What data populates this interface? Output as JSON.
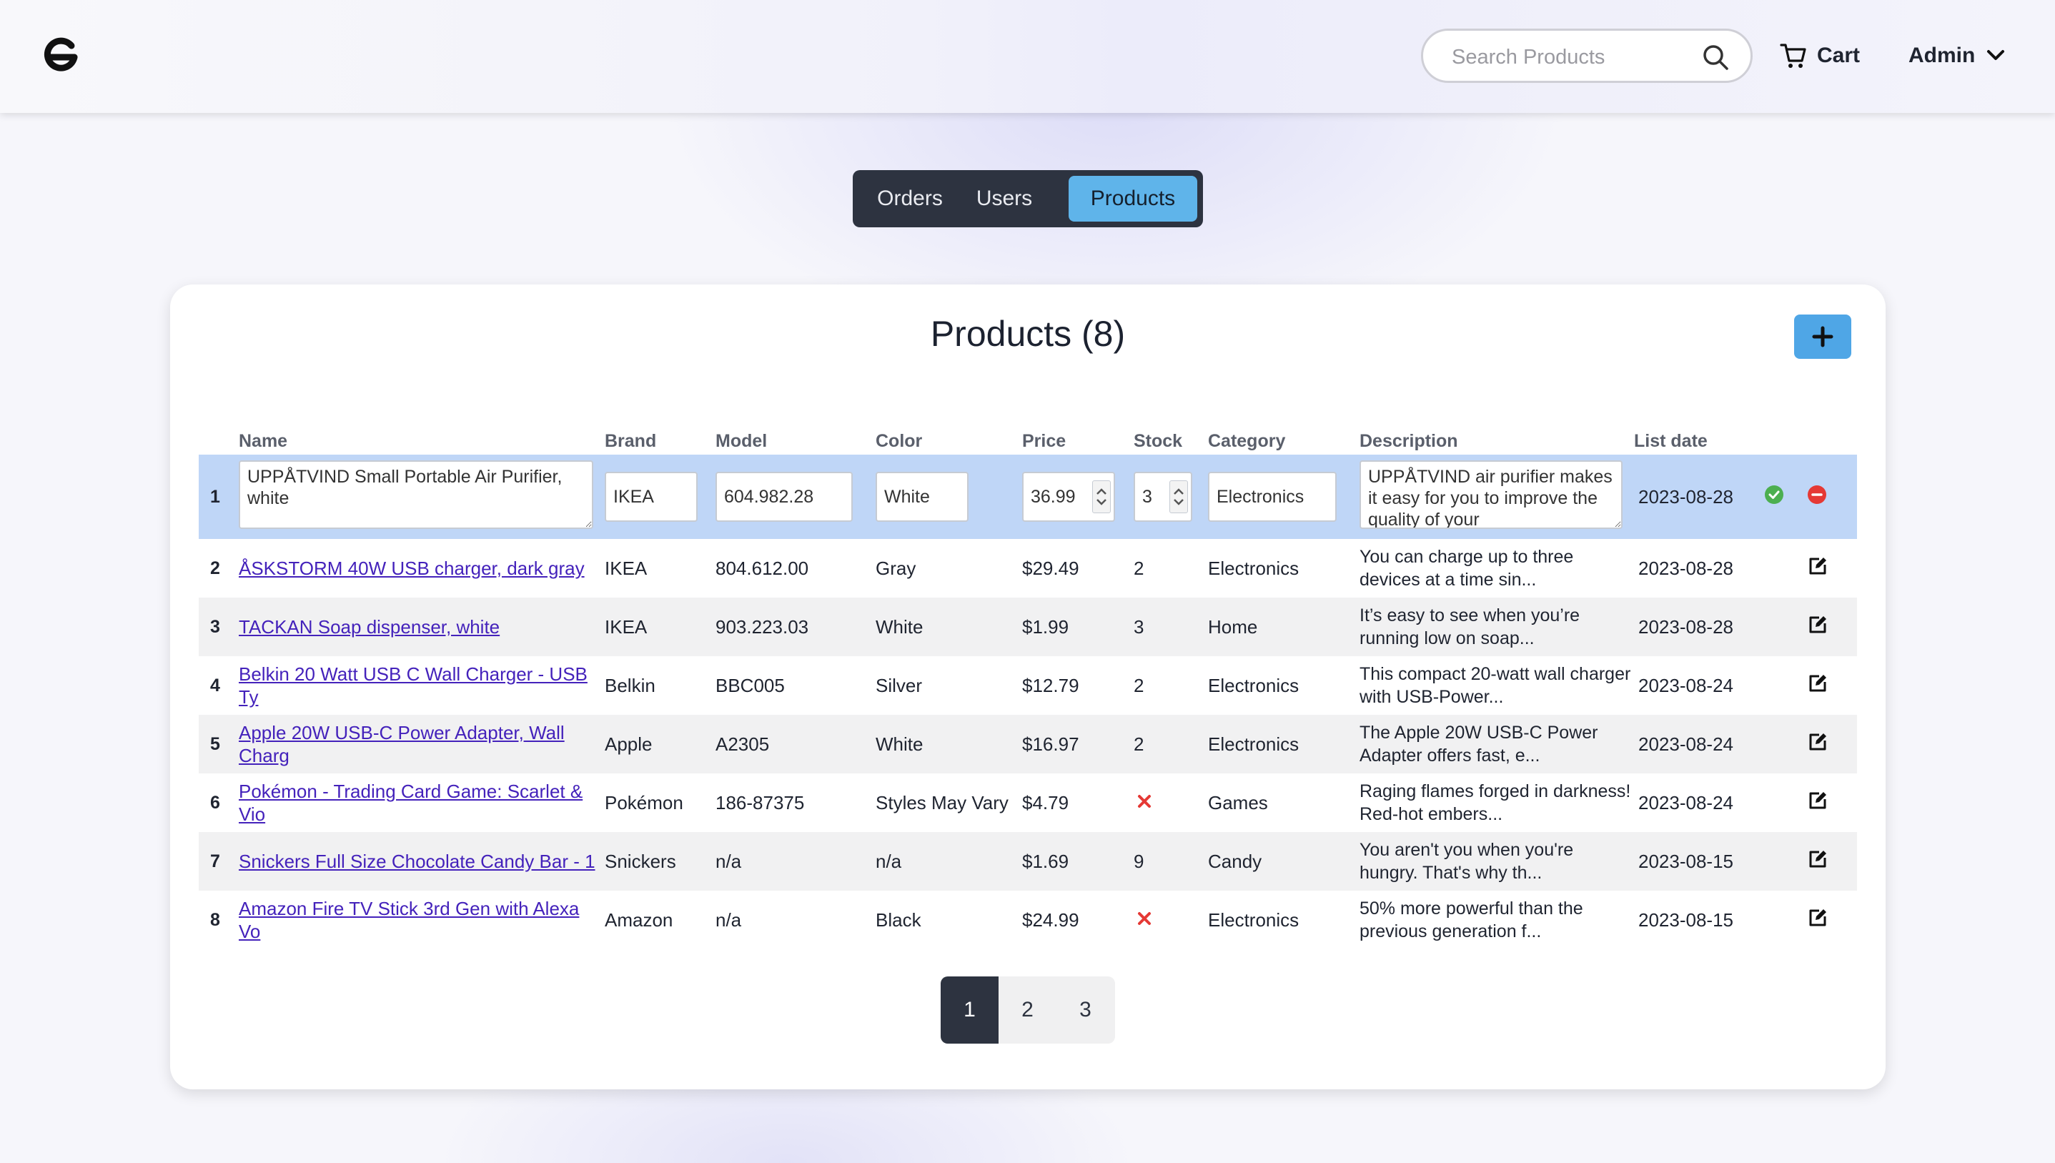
{
  "header": {
    "logo": "e-logo",
    "search": {
      "placeholder": "Search Products",
      "value": ""
    },
    "cart_label": "Cart",
    "user_label": "Admin"
  },
  "tabs": [
    {
      "label": "Orders",
      "active": false
    },
    {
      "label": "Users",
      "active": false
    },
    {
      "label": "Products",
      "active": true
    }
  ],
  "products": {
    "title": "Products (8)",
    "columns": [
      "Name",
      "Brand",
      "Model",
      "Color",
      "Price",
      "Stock",
      "Category",
      "Description",
      "List date"
    ],
    "editing_row": {
      "index": "1",
      "name": "UPPÅTVIND Small Portable Air Purifier, white",
      "brand": "IKEA",
      "model": "604.982.28",
      "color": "White",
      "price": "36.99",
      "stock": "3",
      "category": "Electronics",
      "description": "UPPÅTVIND air purifier makes it easy for you to improve the quality of your",
      "list_date": "2023-08-28"
    },
    "rows": [
      {
        "index": "2",
        "name": "ÅSKSTORM 40W USB charger, dark gray",
        "brand": "IKEA",
        "model": "804.612.00",
        "color": "Gray",
        "price": "$29.49",
        "stock": "2",
        "category": "Electronics",
        "description": "You can charge up to three devices at a time sin...",
        "list_date": "2023-08-28"
      },
      {
        "index": "3",
        "name": "TACKAN Soap dispenser, white",
        "brand": "IKEA",
        "model": "903.223.03",
        "color": "White",
        "price": "$1.99",
        "stock": "3",
        "category": "Home",
        "description": "It’s easy to see when you’re running low on soap...",
        "list_date": "2023-08-28"
      },
      {
        "index": "4",
        "name": "Belkin 20 Watt USB C Wall Charger - USB Ty",
        "brand": "Belkin",
        "model": "BBC005",
        "color": "Silver",
        "price": "$12.79",
        "stock": "2",
        "category": "Electronics",
        "description": "This compact 20-watt wall charger with USB-Power...",
        "list_date": "2023-08-24"
      },
      {
        "index": "5",
        "name": "Apple 20W USB-C Power Adapter, Wall Charg",
        "brand": "Apple",
        "model": "A2305",
        "color": "White",
        "price": "$16.97",
        "stock": "2",
        "category": "Electronics",
        "description": "The Apple 20W USB-C Power Adapter offers fast, e...",
        "list_date": "2023-08-24"
      },
      {
        "index": "6",
        "name": "Pokémon - Trading Card Game: Scarlet & Vio",
        "brand": "Pokémon",
        "model": "186-87375",
        "color": "Styles May Vary",
        "price": "$4.79",
        "stock": "",
        "out_of_stock": true,
        "category": "Games",
        "description": "Raging flames forged in darkness! Red-hot embers...",
        "list_date": "2023-08-24"
      },
      {
        "index": "7",
        "name": "Snickers Full Size Chocolate Candy Bar - 1",
        "brand": "Snickers",
        "model": "n/a",
        "color": "n/a",
        "price": "$1.69",
        "stock": "9",
        "category": "Candy",
        "description": "You aren't you when you're hungry. That's why th...",
        "list_date": "2023-08-15"
      },
      {
        "index": "8",
        "name": "Amazon Fire TV Stick 3rd Gen with Alexa Vo",
        "brand": "Amazon",
        "model": "n/a",
        "color": "Black",
        "price": "$24.99",
        "stock": "",
        "out_of_stock": true,
        "category": "Electronics",
        "description": "50% more powerful than the previous generation f...",
        "list_date": "2023-08-15"
      }
    ]
  },
  "pagination": {
    "pages": [
      "1",
      "2",
      "3"
    ],
    "current": "1"
  },
  "colors": {
    "accent": "#5fb4ea",
    "dark": "#2d3340",
    "edit_row": "#bfd6f7",
    "link": "#4422bb",
    "success": "#4caf50",
    "danger": "#e53935"
  }
}
